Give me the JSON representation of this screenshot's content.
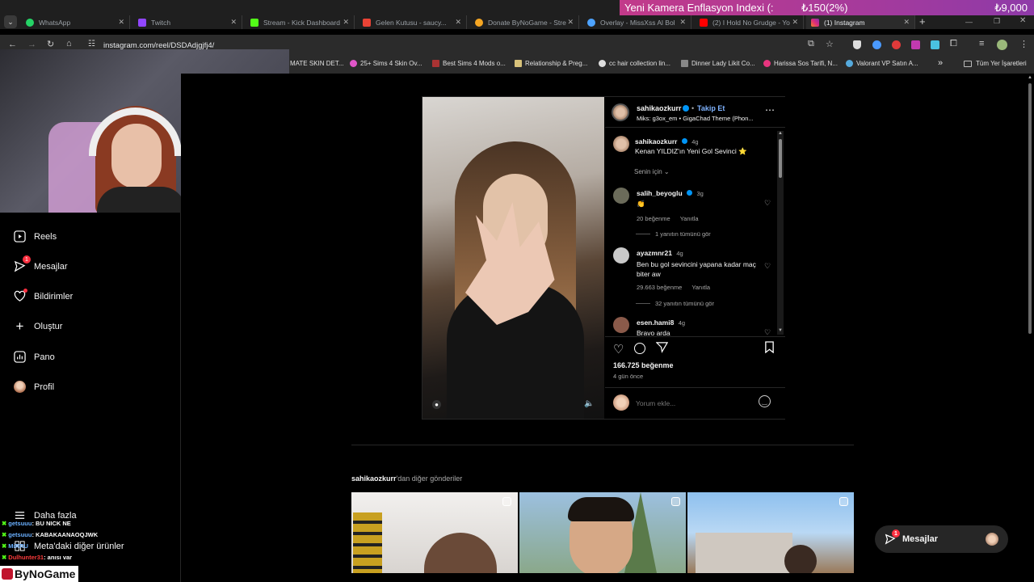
{
  "tabs": [
    {
      "label": "WhatsApp",
      "color": "#25d366"
    },
    {
      "label": "Twitch",
      "color": "#9146ff"
    },
    {
      "label": "Stream - Kick Dashboard",
      "color": "#53fc18"
    },
    {
      "label": "Gelen Kutusu - saucy...",
      "color": "#ea4335"
    },
    {
      "label": "Donate ByNoGame - Stre",
      "color": "#f5a623"
    },
    {
      "label": "Overlay - MissXss Al Bol",
      "color": "#4da3ff"
    },
    {
      "label": "(2) I Hold No Grudge - Yo",
      "color": "#ff0000"
    },
    {
      "label": "(1) Instagram",
      "color": "#e1306c"
    }
  ],
  "ticker": {
    "title": "Yeni Kamera Enflasyon Indexi (:",
    "delta": "₺150(2%)",
    "price": "₺9,000"
  },
  "address": {
    "url": "instagram.com/reel/DSDAdjgjfj4/"
  },
  "bookmarks": [
    {
      "label": "MATE SKIN DET...",
      "color": "#777"
    },
    {
      "label": "25+ Sims 4 Skin Ov...",
      "color": "#e056c8"
    },
    {
      "label": "Best Sims 4 Mods o...",
      "color": "#a33"
    },
    {
      "label": "Relationship & Preg...",
      "color": "#d8c27a"
    },
    {
      "label": "cc hair collection lin...",
      "color": "#ddd"
    },
    {
      "label": "Dinner Lady Likit Co...",
      "color": "#888"
    },
    {
      "label": "Harissa Sos Tarifi, N...",
      "color": "#e8357f"
    },
    {
      "label": "Valorant VP Satın A...",
      "color": "#5ad"
    },
    {
      "label": "»",
      "color": "#2b2b2b"
    },
    {
      "label": "Tüm Yer İşaretleri",
      "color": "#999"
    }
  ],
  "nav": [
    {
      "label": "Reels",
      "icon": "reels-icon"
    },
    {
      "label": "Mesajlar",
      "icon": "messenger-icon",
      "badge": "1"
    },
    {
      "label": "Bildirimler",
      "icon": "heart-icon",
      "dot": true
    },
    {
      "label": "Oluştur",
      "icon": "plus-icon"
    },
    {
      "label": "Pano",
      "icon": "chart-icon"
    },
    {
      "label": "Profil",
      "icon": "avatar"
    },
    {
      "label": "Daha fazla",
      "icon": "menu-icon"
    },
    {
      "label": "Meta'daki diğer ürünler",
      "icon": "meta-icon"
    }
  ],
  "post": {
    "username": "sahikaozkurr",
    "follow": "Takip Et",
    "audio": "Miks: g3ox_em • GigaChad Theme (Phon...",
    "caption_user": "sahikaozkurr",
    "caption_time": "4g",
    "caption": "Kenan YILDIZ'ın Yeni Gol Sevinci ⭐",
    "for_you": "Senin için",
    "likes": "166.725 beğenme",
    "date": "4 gün önce",
    "comment_placeholder": "Yorum ekle..."
  },
  "comments": [
    {
      "user": "salih_beyoglu",
      "verified": true,
      "time": "3g",
      "text": "👏",
      "likes": "20 beğenme",
      "reply": "Yanıtla",
      "view_replies": "1 yanıtın tümünü gör",
      "avatar_color": "#6b6b5a"
    },
    {
      "user": "ayazmnr21",
      "verified": false,
      "time": "4g",
      "text": "Ben bu gol sevincini yapana kadar maç biter aw",
      "likes": "29.663 beğenme",
      "reply": "Yanıtla",
      "view_replies": "32 yanıtın tümünü gör",
      "avatar_color": "#c9c9c9"
    },
    {
      "user": "esen.hami8",
      "verified": false,
      "time": "4g",
      "text": "Bravo arda",
      "likes": "",
      "reply": "",
      "view_replies": "",
      "avatar_color": "#8a5a4a"
    }
  ],
  "more": {
    "user": "sahikaozkurr",
    "suffix": "'dan diğer gönderiler"
  },
  "floating": {
    "label": "Mesajlar",
    "badge": "1"
  },
  "chat": [
    {
      "user": "getsuuu",
      "text": ": BU NICK NE",
      "color": "#6ab0ff"
    },
    {
      "user": "getsuuu",
      "text": ": KABAKAANAOQJWK",
      "color": "#6ab0ff"
    },
    {
      "user": "MiRRU",
      "text": "",
      "color": "#6ab0ff"
    },
    {
      "user": "Dulhunter31",
      "text": ": anısı var",
      "color": "#ff3b3b"
    }
  ],
  "branding": {
    "logo": "ByNoGame"
  }
}
